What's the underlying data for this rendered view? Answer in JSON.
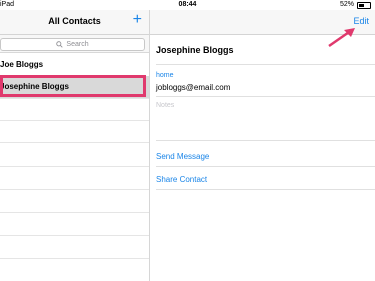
{
  "status_bar": {
    "carrier": "iPad",
    "time": "08:44",
    "battery": "52%"
  },
  "contacts_list": {
    "title": "All Contacts",
    "add_label": "+",
    "search_placeholder": "Search",
    "contacts": [
      "Joe Bloggs",
      "Josephine Bloggs"
    ],
    "selected": "Josephine Bloggs"
  },
  "detail": {
    "edit_label": "Edit",
    "name": "Josephine Bloggs",
    "email_label": "home",
    "email_value": "jobloggs@email.com",
    "notes_label": "Notes",
    "actions": [
      "Send Message",
      "Share Contact"
    ]
  },
  "colors": {
    "accent": "#1a85e8",
    "highlight": "#e0396d",
    "selected_row": "#d9d9d9"
  }
}
